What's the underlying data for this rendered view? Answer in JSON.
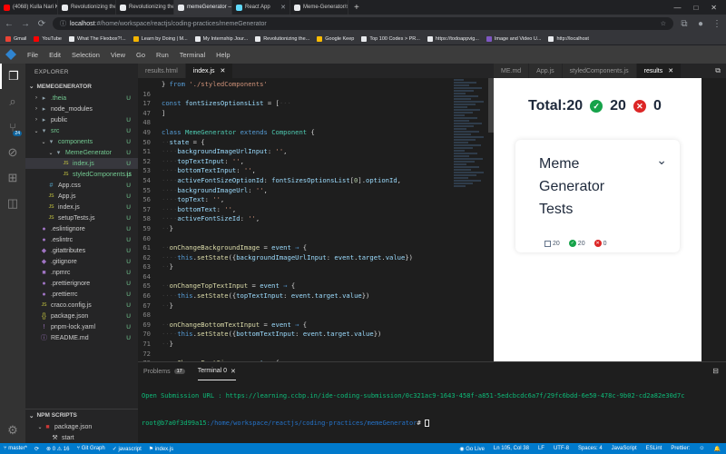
{
  "browser": {
    "tabs": [
      {
        "label": "(4068) Kulla Nari Kootam",
        "color": "#ff0000",
        "active": false
      },
      {
        "label": "Revolutionizing the Job Mark",
        "color": "#e8eaed",
        "active": false
      },
      {
        "label": "Revolutionizing the Job Mark",
        "color": "#e8eaed",
        "active": false
      },
      {
        "label": "memeGenerator — CCBP IDE",
        "color": "#e8eaed",
        "active": true
      },
      {
        "label": "React App",
        "color": "#61dafb",
        "active": false
      },
      {
        "label": "Meme-Generator/styledComp",
        "color": "#e8eaed",
        "active": false
      }
    ],
    "new_tab": "+",
    "url_host": "localhost",
    "url_path": ":#/home/workspace/reactjs/coding-practices/memeGenerator",
    "bookmarks": [
      {
        "label": "Gmail",
        "color": "#ea4335"
      },
      {
        "label": "YouTube",
        "color": "#ff0000"
      },
      {
        "label": "What The Flexbox?!...",
        "color": "#e8eaed"
      },
      {
        "label": "Learn by Doing | M...",
        "color": "#f4b400"
      },
      {
        "label": "My Internship Jour...",
        "color": "#e8eaed"
      },
      {
        "label": "Revolutionizing the...",
        "color": "#e8eaed"
      },
      {
        "label": "Google Keep",
        "color": "#fbbc04"
      },
      {
        "label": "Top 100 Codes > PR...",
        "color": "#e8eaed"
      },
      {
        "label": "https://todoappvig...",
        "color": "#e8eaed"
      },
      {
        "label": "Image and Video U...",
        "color": "#7e57c2"
      },
      {
        "label": "http://localhost",
        "color": "#e8eaed"
      }
    ]
  },
  "ide": {
    "menu": [
      "File",
      "Edit",
      "Selection",
      "View",
      "Go",
      "Run",
      "Terminal",
      "Help"
    ],
    "scm_badge": "24",
    "explorer_title": "EXPLORER",
    "workspace": "MEMEGENERATOR",
    "tree": [
      {
        "label": ".theia",
        "indent": 1,
        "chev": "›",
        "icon": "▸",
        "status": "U",
        "mod": true
      },
      {
        "label": "node_modules",
        "indent": 1,
        "chev": "›",
        "icon": "▸",
        "status": "",
        "mod": false
      },
      {
        "label": "public",
        "indent": 1,
        "chev": "›",
        "icon": "▸",
        "status": "U",
        "mod": false
      },
      {
        "label": "src",
        "indent": 1,
        "chev": "⌄",
        "icon": "▾",
        "status": "U",
        "mod": true
      },
      {
        "label": "components",
        "indent": 2,
        "chev": "⌄",
        "icon": "▾",
        "status": "U",
        "mod": true
      },
      {
        "label": "MemeGenerator",
        "indent": 3,
        "chev": "⌄",
        "icon": "▾",
        "status": "U",
        "mod": true
      },
      {
        "label": "index.js",
        "indent": 4,
        "chev": "",
        "icon": "JS",
        "status": "U",
        "mod": true,
        "sel": true
      },
      {
        "label": "styledComponents.js",
        "indent": 4,
        "chev": "",
        "icon": "JS",
        "status": "U",
        "mod": true
      },
      {
        "label": "App.css",
        "indent": 2,
        "chev": "",
        "icon": "#",
        "status": "U",
        "mod": false
      },
      {
        "label": "App.js",
        "indent": 2,
        "chev": "",
        "icon": "JS",
        "status": "U",
        "mod": false
      },
      {
        "label": "index.js",
        "indent": 2,
        "chev": "",
        "icon": "JS",
        "status": "U",
        "mod": false
      },
      {
        "label": "setupTests.js",
        "indent": 2,
        "chev": "",
        "icon": "JS",
        "status": "U",
        "mod": false
      },
      {
        "label": ".eslintignore",
        "indent": 1,
        "chev": "",
        "icon": "●",
        "status": "U",
        "mod": false
      },
      {
        "label": ".eslintrc",
        "indent": 1,
        "chev": "",
        "icon": "●",
        "status": "U",
        "mod": false
      },
      {
        "label": ".gitattributes",
        "indent": 1,
        "chev": "",
        "icon": "◆",
        "status": "U",
        "mod": false
      },
      {
        "label": ".gitignore",
        "indent": 1,
        "chev": "",
        "icon": "◆",
        "status": "U",
        "mod": false
      },
      {
        "label": ".npmrc",
        "indent": 1,
        "chev": "",
        "icon": "■",
        "status": "U",
        "mod": false
      },
      {
        "label": ".prettierignore",
        "indent": 1,
        "chev": "",
        "icon": "●",
        "status": "U",
        "mod": false
      },
      {
        "label": ".prettierrc",
        "indent": 1,
        "chev": "",
        "icon": "●",
        "status": "U",
        "mod": false
      },
      {
        "label": "craco.config.js",
        "indent": 1,
        "chev": "",
        "icon": "JS",
        "status": "U",
        "mod": false
      },
      {
        "label": "package.json",
        "indent": 1,
        "chev": "",
        "icon": "{}",
        "status": "U",
        "mod": false
      },
      {
        "label": "pnpm-lock.yaml",
        "indent": 1,
        "chev": "",
        "icon": "!",
        "status": "U",
        "mod": false
      },
      {
        "label": "README.md",
        "indent": 1,
        "chev": "",
        "icon": "ⓘ",
        "status": "U",
        "mod": false
      }
    ],
    "npm_scripts_title": "NPM SCRIPTS",
    "npm_items": [
      "package.json",
      "start"
    ],
    "editor_tabs": [
      "results.html",
      "index.js"
    ],
    "split_tabs": [
      "ME.md",
      "App.js",
      "styledComponents.js",
      "results"
    ],
    "code_lines": [
      {
        "num": "",
        "html": "<span class='p'>} </span><span class='k'>from</span><span class='s'> './styledComponents'</span>"
      },
      {
        "num": "16",
        "html": ""
      },
      {
        "num": "17",
        "html": "<span class='k'>const</span> <span class='v'>fontSizesOptionsList</span> <span class='p'>= [</span><span class='guide'>···</span>"
      },
      {
        "num": "47",
        "html": "<span class='p'>]</span>"
      },
      {
        "num": "48",
        "html": ""
      },
      {
        "num": "49",
        "html": "<span class='k'>class</span> <span class='c'>MemeGenerator</span> <span class='k'>extends</span> <span class='c'>Component</span> <span class='p'>{</span>"
      },
      {
        "num": "50",
        "html": "<span class='guide'>··</span><span class='v'>state</span> <span class='p'>= {</span>"
      },
      {
        "num": "51",
        "html": "<span class='guide'>····</span><span class='v'>backgroundImageUrlInput</span><span class='p'>: </span><span class='s'>''</span><span class='p'>,</span>"
      },
      {
        "num": "52",
        "html": "<span class='guide'>····</span><span class='v'>topTextInput</span><span class='p'>: </span><span class='s'>''</span><span class='p'>,</span>"
      },
      {
        "num": "53",
        "html": "<span class='guide'>····</span><span class='v'>bottomTextInput</span><span class='p'>: </span><span class='s'>''</span><span class='p'>,</span>"
      },
      {
        "num": "54",
        "html": "<span class='guide'>····</span><span class='v'>activeFontSizeOptionId</span><span class='p'>: </span><span class='v'>fontSizesOptionsList</span><span class='p'>[</span><span class='n'>0</span><span class='p'>].</span><span class='v'>optionId</span><span class='p'>,</span>"
      },
      {
        "num": "55",
        "html": "<span class='guide'>····</span><span class='v'>backgroundImageUrl</span><span class='p'>: </span><span class='s'>''</span><span class='p'>,</span>"
      },
      {
        "num": "56",
        "html": "<span class='guide'>····</span><span class='v'>topText</span><span class='p'>: </span><span class='s'>''</span><span class='p'>,</span>"
      },
      {
        "num": "57",
        "html": "<span class='guide'>····</span><span class='v'>bottomText</span><span class='p'>: </span><span class='s'>''</span><span class='p'>,</span>"
      },
      {
        "num": "58",
        "html": "<span class='guide'>····</span><span class='v'>activeFontSizeId</span><span class='p'>: </span><span class='s'>''</span><span class='p'>,</span>"
      },
      {
        "num": "59",
        "html": "<span class='guide'>··</span><span class='p'>}</span>"
      },
      {
        "num": "60",
        "html": ""
      },
      {
        "num": "61",
        "html": "<span class='guide'>··</span><span class='f'>onChangeBackgroundImage</span> <span class='p'>= </span><span class='v'>event</span> <span class='k'>⇒</span> <span class='p'>{</span>"
      },
      {
        "num": "62",
        "html": "<span class='guide'>····</span><span class='k'>this</span><span class='p'>.</span><span class='f'>setState</span><span class='p'>({</span><span class='v'>backgroundImageUrlInput</span><span class='p'>: </span><span class='v'>event</span><span class='p'>.</span><span class='v'>target</span><span class='p'>.</span><span class='v'>value</span><span class='p'>})</span>"
      },
      {
        "num": "63",
        "html": "<span class='guide'>··</span><span class='p'>}</span>"
      },
      {
        "num": "64",
        "html": ""
      },
      {
        "num": "65",
        "html": "<span class='guide'>··</span><span class='f'>onChangeTopTextInput</span> <span class='p'>= </span><span class='v'>event</span> <span class='k'>⇒</span> <span class='p'>{</span>"
      },
      {
        "num": "66",
        "html": "<span class='guide'>····</span><span class='k'>this</span><span class='p'>.</span><span class='f'>setState</span><span class='p'>({</span><span class='v'>topTextInput</span><span class='p'>: </span><span class='v'>event</span><span class='p'>.</span><span class='v'>target</span><span class='p'>.</span><span class='v'>value</span><span class='p'>})</span>"
      },
      {
        "num": "67",
        "html": "<span class='guide'>··</span><span class='p'>}</span>"
      },
      {
        "num": "68",
        "html": ""
      },
      {
        "num": "69",
        "html": "<span class='guide'>··</span><span class='f'>onChangeBottomTextInput</span> <span class='p'>= </span><span class='v'>event</span> <span class='k'>⇒</span> <span class='p'>{</span>"
      },
      {
        "num": "70",
        "html": "<span class='guide'>····</span><span class='k'>this</span><span class='p'>.</span><span class='f'>setState</span><span class='p'>({</span><span class='v'>bottomTextInput</span><span class='p'>: </span><span class='v'>event</span><span class='p'>.</span><span class='v'>target</span><span class='p'>.</span><span class='v'>value</span><span class='p'>})</span>"
      },
      {
        "num": "71",
        "html": "<span class='guide'>··</span><span class='p'>}</span>"
      },
      {
        "num": "72",
        "html": ""
      },
      {
        "num": "73",
        "html": "<span class='guide'>··</span><span class='f'>onChangeFontSize</span> <span class='p'>= </span><span class='v'>event</span> <span class='k'>⇒</span> <span class='p'>{</span>"
      }
    ],
    "terminal": {
      "problems_label": "Problems",
      "problems_count": "17",
      "active_tab": "Terminal 0",
      "output": "Open Submission URL : https://learning.ccbp.in/ide-coding-submission/0c321ac9-1643-458f-a851-5edcbcdc6a7f/29fc6bdd-6e50-478c-9b02-cd2a82e30d7c",
      "prompt_user": "root@b7a0f3d99a15",
      "prompt_path": ":/home/workspace/reactjs/coding-practices/memeGenerator",
      "prompt_end": "# "
    },
    "status": {
      "branch": "master*",
      "sync": "⟳",
      "errors": "0",
      "warnings": "16",
      "git_graph": "Git Graph",
      "lang_item": "javascript",
      "file": "index.js",
      "go_live": "Go Live",
      "position": "Ln 105, Col 38",
      "eol": "LF",
      "encoding": "UTF-8",
      "spaces": "Spaces: 4",
      "language": "JavaScript",
      "eslint": "ESLint",
      "prettier": "Prettier:"
    }
  },
  "preview": {
    "total_label": "Total:20",
    "passed": "20",
    "failed": "0",
    "card_title": "Meme Generator Tests",
    "card_total": "20",
    "card_passed": "20",
    "card_failed": "0"
  }
}
